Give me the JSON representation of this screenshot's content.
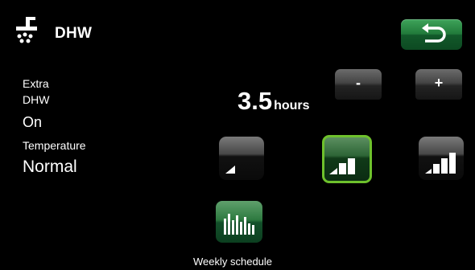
{
  "header": {
    "title": "DHW",
    "icon": "tap-icon",
    "back_icon": "back-arrow-icon"
  },
  "extra_dhw": {
    "label_line1": "Extra",
    "label_line2": "DHW",
    "value": "On"
  },
  "temperature": {
    "label": "Temperature",
    "value": "Normal"
  },
  "duration": {
    "value": "3.5",
    "unit": "hours"
  },
  "controls": {
    "minus_label": "-",
    "plus_label": "+"
  },
  "levels": {
    "selected": "normal",
    "options": [
      "low",
      "normal",
      "high"
    ]
  },
  "weekly": {
    "label": "Weekly schedule",
    "icon": "schedule-bars-icon"
  },
  "colors": {
    "background": "#000000",
    "accent_green": "#2e7a40",
    "selected_border": "#6ec12c"
  }
}
